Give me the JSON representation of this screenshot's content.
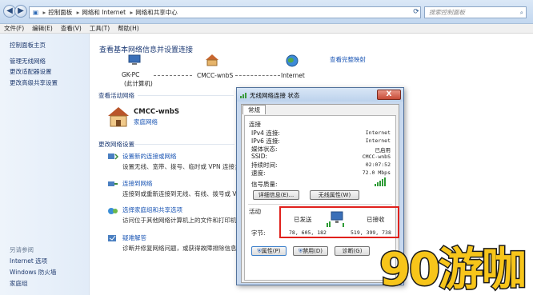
{
  "address": {
    "crumbs": [
      "控制面板",
      "网络和 Internet",
      "网络和共享中心"
    ],
    "search_placeholder": "搜索控制面板"
  },
  "menu": [
    "文件(F)",
    "编辑(E)",
    "查看(V)",
    "工具(T)",
    "帮助(H)"
  ],
  "left_pane": {
    "links": [
      "控制面板主页",
      "管理无线网络",
      "更改适配器设置",
      "更改高级共享设置"
    ],
    "see_also_label": "另请参阅",
    "see_also": [
      "Internet 选项",
      "Windows 防火墙",
      "家庭组"
    ]
  },
  "main": {
    "title": "查看基本网络信息并设置连接",
    "map_full_link": "查看完整映射",
    "map": {
      "pc_name": "GK-PC",
      "pc_sub": "(此计算机)",
      "network": "CMCC-wnbS",
      "internet": "Internet"
    },
    "active_title": "查看活动网络",
    "active_network_name": "CMCC-wnbS",
    "active_network_type": "家庭网络",
    "change_title": "更改网络设置",
    "tasks": [
      {
        "link": "设置新的连接或网络",
        "desc": "设置无线、宽带、拨号、临时或 VPN 连接；或"
      },
      {
        "link": "连接到网络",
        "desc": "连接到或重新连接到无线、有线、拨号或 VPN"
      },
      {
        "link": "选择家庭组和共享选项",
        "desc": "访问位于其他网络计算机上的文件和打印机，"
      },
      {
        "link": "疑难解答",
        "desc": "诊断并修复网络问题，或获得故障排除信息。"
      }
    ]
  },
  "dialog": {
    "title": "无线网络连接 状态",
    "close_glyph": "X",
    "tab": "常规",
    "connection_label": "连接",
    "rows": [
      {
        "label": "IPv4 连接:",
        "value": "Internet"
      },
      {
        "label": "IPv6 连接:",
        "value": "Internet"
      },
      {
        "label": "媒体状态:",
        "value": "已启用"
      },
      {
        "label": "SSID:",
        "value": "CMCC-wnbS"
      },
      {
        "label": "持续时间:",
        "value": "02:07:52"
      },
      {
        "label": "速度:",
        "value": "72.0 Mbps"
      }
    ],
    "signal_label": "信号质量:",
    "btn_details": "详细信息(E)...",
    "btn_wireless": "无线属性(W)",
    "activity_label": "活动",
    "sent_label": "已发送",
    "received_label": "已接收",
    "bytes_label": "字节:",
    "bytes_sent": "78, 605, 182",
    "bytes_received": "519, 399, 738",
    "btn_properties": "属性(P)",
    "btn_disable": "禁用(D)",
    "btn_diagnose": "诊断(G)"
  },
  "watermark": "90游咖",
  "colors": {
    "link": "#1a55b4",
    "highlight_box": "#e0211c",
    "watermark_fill": "#f7c51a"
  }
}
